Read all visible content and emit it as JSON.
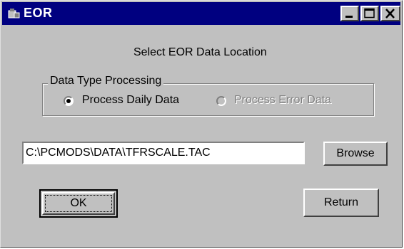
{
  "window": {
    "title": "EOR",
    "icon": "app-icon",
    "controls": [
      "minimize-icon",
      "maximize-icon",
      "close-icon"
    ]
  },
  "heading": "Select EOR Data Location",
  "group": {
    "legend": "Data Type Processing",
    "options": [
      {
        "label": "Process Daily Data",
        "selected": true,
        "enabled": true
      },
      {
        "label": "Process Error Data",
        "selected": false,
        "enabled": false
      }
    ]
  },
  "path_field": {
    "value": "C:\\PCMODS\\DATA\\TFRSCALE.TAC"
  },
  "buttons": {
    "browse": "Browse",
    "ok": "OK",
    "return": "Return"
  },
  "colors": {
    "titlebar": "#000080",
    "face": "#c0c0c0",
    "disabled_text": "#808080"
  }
}
